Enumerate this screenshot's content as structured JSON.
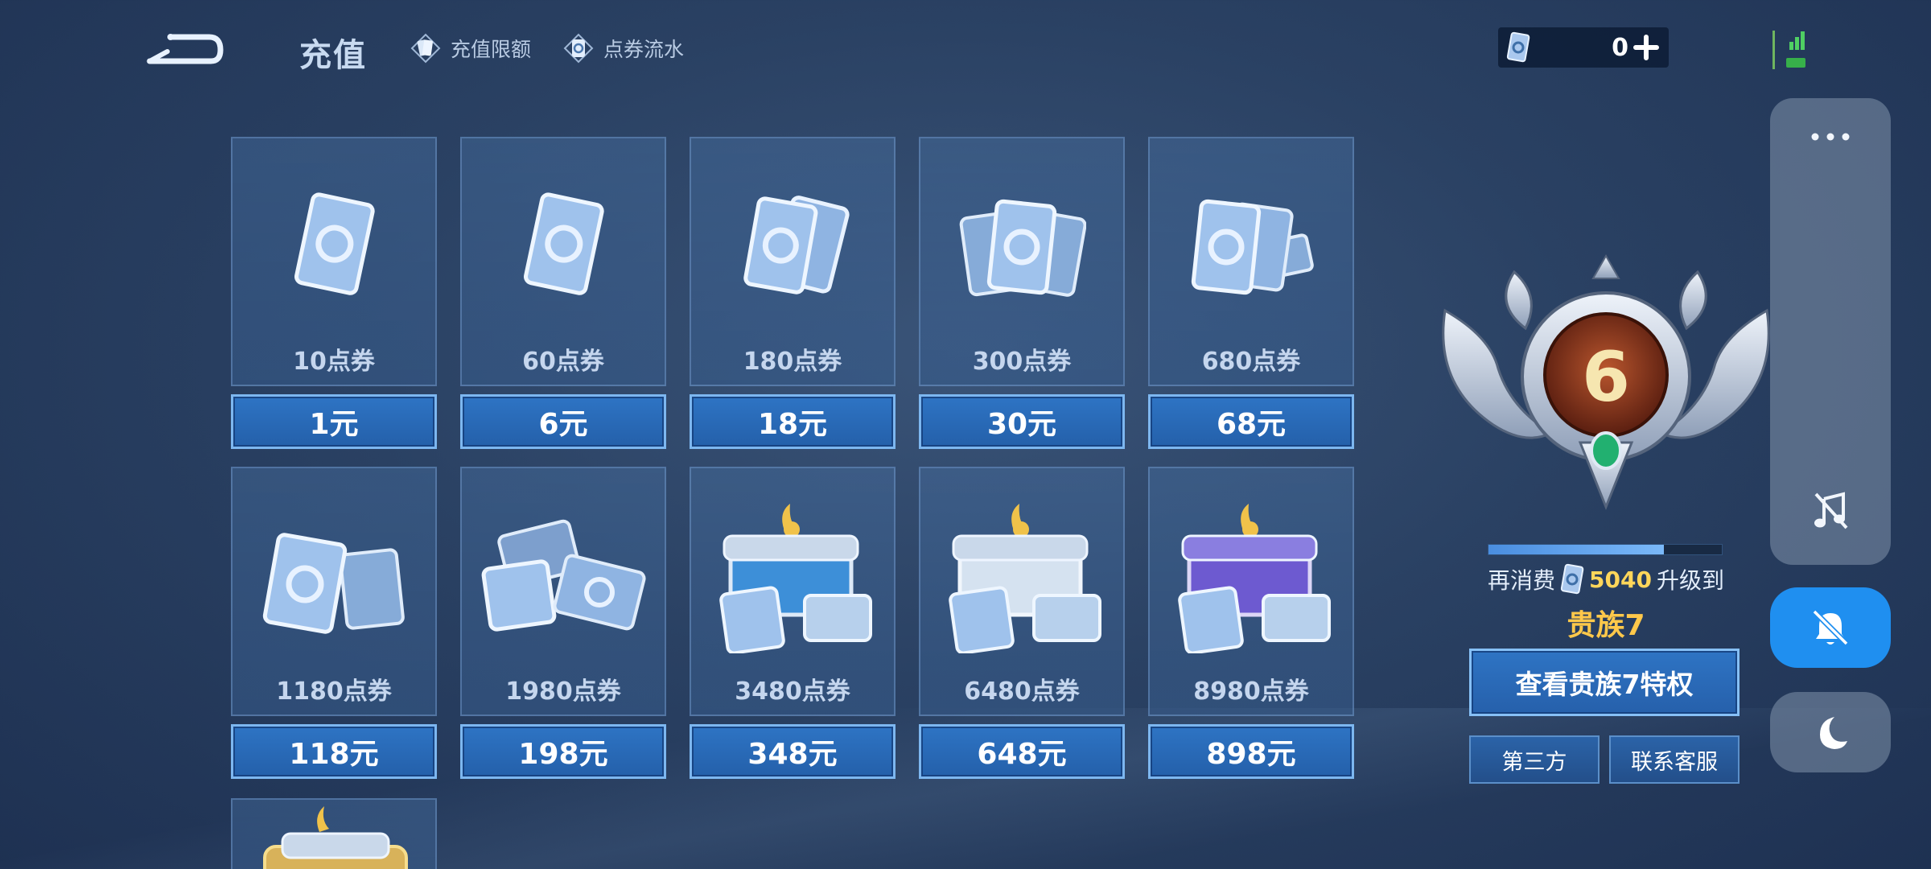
{
  "header": {
    "title": "充值",
    "links": [
      {
        "label": "充值限额",
        "icon": "card-icon"
      },
      {
        "label": "点券流水",
        "icon": "coupon-log-icon"
      }
    ],
    "balance": "0"
  },
  "packages": [
    {
      "coupons": "10点券",
      "price": "1元"
    },
    {
      "coupons": "60点券",
      "price": "6元"
    },
    {
      "coupons": "180点券",
      "price": "18元"
    },
    {
      "coupons": "300点券",
      "price": "30元"
    },
    {
      "coupons": "680点券",
      "price": "68元"
    },
    {
      "coupons": "1180点券",
      "price": "118元"
    },
    {
      "coupons": "1980点券",
      "price": "198元"
    },
    {
      "coupons": "3480点券",
      "price": "348元"
    },
    {
      "coupons": "6480点券",
      "price": "648元"
    },
    {
      "coupons": "8980点券",
      "price": "898元"
    }
  ],
  "vip": {
    "level": "6",
    "progress_fraction": 0.75,
    "prefix": "再消费",
    "amount": "5040",
    "suffix": "升级到",
    "next_level": "贵族7",
    "view_button": "查看贵族7特权",
    "third_party_button": "第三方",
    "service_button": "联系客服"
  },
  "colors": {
    "accent": "#2e74c4",
    "gold": "#ffc84a",
    "mute_active": "#1f8ff0"
  }
}
